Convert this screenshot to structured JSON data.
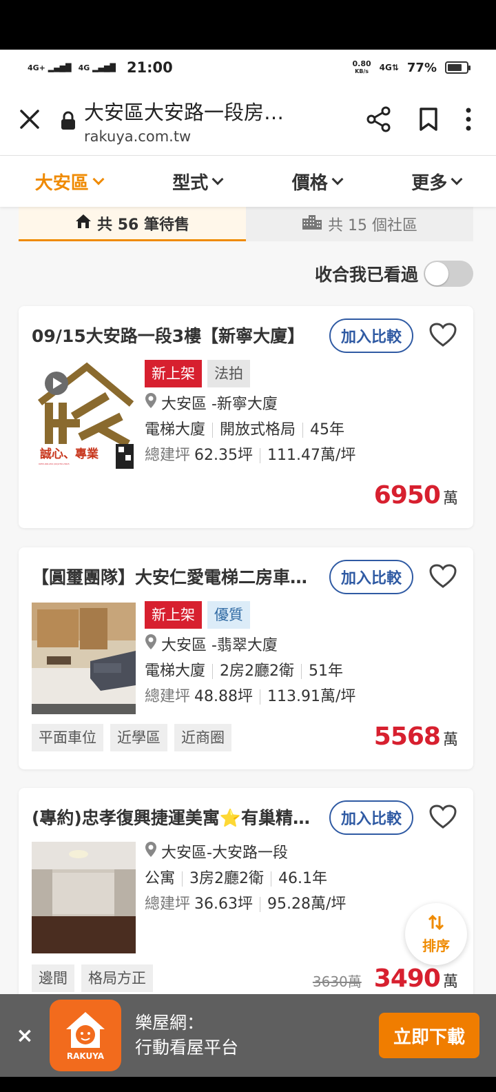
{
  "status_bar": {
    "signal1": "4G+",
    "signal2": "4G",
    "time": "21:00",
    "speed_value": "0.80",
    "speed_unit": "KB/s",
    "network": "4G",
    "battery_pct": "77%",
    "battery_level": 0.77
  },
  "browser": {
    "page_title": "大安區大安路一段房…",
    "domain": "rakuya.com.tw"
  },
  "filters": [
    {
      "label": "大安區",
      "active": true
    },
    {
      "label": "型式",
      "active": false
    },
    {
      "label": "價格",
      "active": false
    },
    {
      "label": "更多",
      "active": false
    }
  ],
  "tabs": {
    "for_sale": "共 56 筆待售",
    "communities": "共 15 個社區"
  },
  "toggle": {
    "label": "收合我已看過",
    "on": false
  },
  "compare_label": "加入比較",
  "listings": [
    {
      "title": "09/15大安路一段3樓【新寧大廈】",
      "badges": [
        "新上架",
        "法拍"
      ],
      "location": "大安區 -新寧大廈",
      "type": "電梯大廈",
      "layout": "開放式格局",
      "age": "45年",
      "area_label": "總建坪",
      "area": "62.35坪",
      "unit_price": "111.47萬/坪",
      "price": "6950",
      "price_unit": "萬",
      "thumb_text": "誠心、專業"
    },
    {
      "title": "【圓璽團隊】大安仁愛電梯二房車…",
      "badges": [
        "新上架",
        "優質"
      ],
      "location": "大安區 -翡翠大廈",
      "type": "電梯大廈",
      "layout": "2房2廳2衛",
      "age": "51年",
      "area_label": "總建坪",
      "area": "48.88坪",
      "unit_price": "113.91萬/坪",
      "tags": [
        "平面車位",
        "近學區",
        "近商圈"
      ],
      "price": "5568",
      "price_unit": "萬"
    },
    {
      "title": "(專約)忠孝復興捷運美寓⭐有巢精…",
      "location": "大安區-大安路一段",
      "type": "公寓",
      "layout": "3房2廳2衛",
      "age": "46.1年",
      "area_label": "總建坪",
      "area": "36.63坪",
      "unit_price": "95.28萬/坪",
      "tags": [
        "邊間",
        "格局方正"
      ],
      "old_price": "3630萬",
      "price": "3490",
      "price_unit": "萬"
    }
  ],
  "sort_button": "排序",
  "banner": {
    "close": "×",
    "app_label": "RAKUYA",
    "line1": "樂屋網：",
    "line2": "行動看屋平台",
    "button": "立即下載"
  },
  "colors": {
    "accent": "#ef8a00",
    "price_red": "#d7202f",
    "compare_blue": "#2f5aa3"
  }
}
